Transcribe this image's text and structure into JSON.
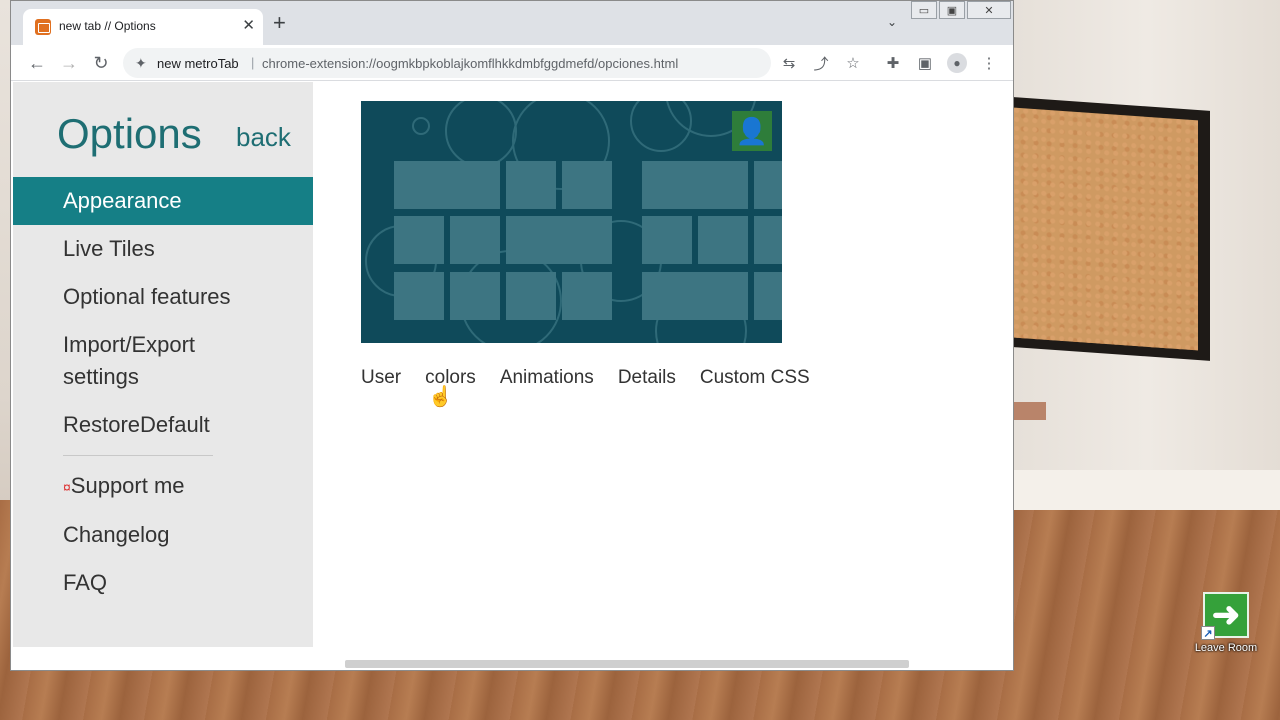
{
  "browser": {
    "tab_title": "new tab // Options",
    "tab_close": "✕",
    "new_tab": "+",
    "tab_search": "⌄",
    "window_controls": [
      "▭",
      "▣",
      "✕"
    ],
    "nav": {
      "back": "←",
      "forward": "→",
      "reload": "↻"
    },
    "omnibox": {
      "ext_icon": "puzzle-icon",
      "site_label": "new metroTab",
      "separator": "|",
      "url": "chrome-extension://oogmkbpkoblajkomflhkkdmbfggdmefd/opciones.html"
    },
    "toolbar_icons": {
      "translate": "⇆",
      "share": "⤴",
      "star": "☆",
      "extensions": "✚",
      "sidepanel": "▣",
      "profile": "●",
      "menu": "⋮"
    }
  },
  "sidebar": {
    "title": "Options",
    "back": "back",
    "items": [
      {
        "label": "Appearance",
        "active": true
      },
      {
        "label": "Live Tiles"
      },
      {
        "label": "Optional features"
      },
      {
        "label": "Import/Export settings"
      },
      {
        "label": "RestoreDefault"
      }
    ],
    "support_star": "¤",
    "support_label": "Support me",
    "secondary_items": [
      {
        "label": "Changelog"
      },
      {
        "label": "FAQ"
      }
    ]
  },
  "content": {
    "preview_user_icon": "user-icon",
    "tabs": [
      {
        "label": "User"
      },
      {
        "label": "colors"
      },
      {
        "label": "Animations"
      },
      {
        "label": "Details"
      },
      {
        "label": "Custom CSS"
      }
    ]
  },
  "desktop": {
    "leave_room_label": "Leave Room",
    "leave_room_icon": "arrow-right-icon",
    "shortcut_arrow": "↗"
  },
  "colors": {
    "accent": "#157f86",
    "title_teal": "#1e6e73",
    "preview_bg": "#0f4a5a",
    "tile": "#3d7582"
  }
}
